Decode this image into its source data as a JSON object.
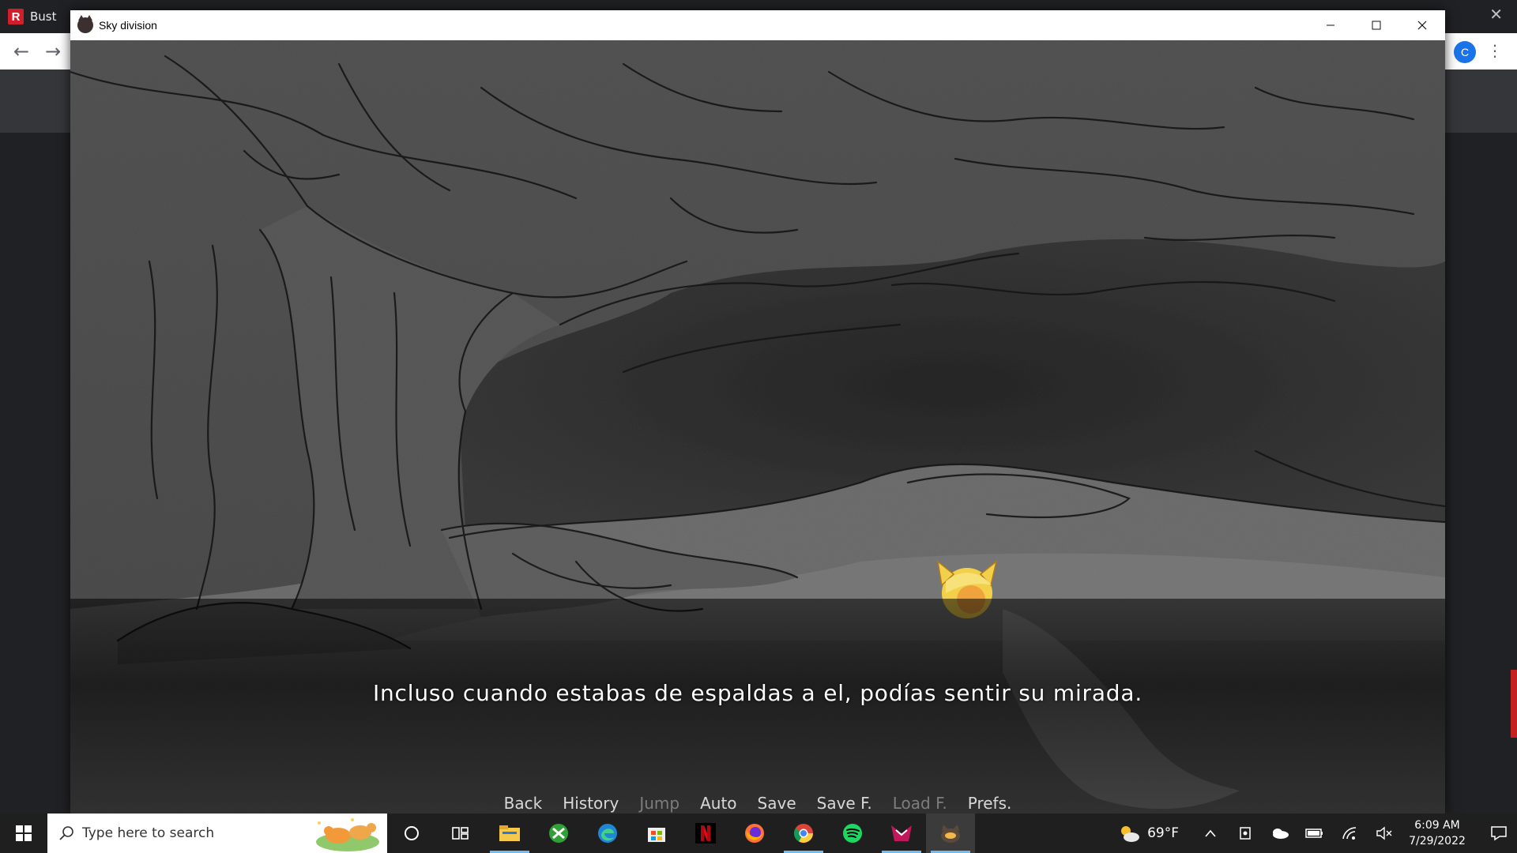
{
  "browser": {
    "first_tab_label": "Bust",
    "profile_initial": "C"
  },
  "window": {
    "title": "Sky division"
  },
  "dialogue": {
    "text": "Incluso cuando estabas de espaldas a el, podías sentir su mirada."
  },
  "quick_menu": [
    {
      "label": "Back",
      "enabled": true
    },
    {
      "label": "History",
      "enabled": true
    },
    {
      "label": "Jump",
      "enabled": false
    },
    {
      "label": "Auto",
      "enabled": true
    },
    {
      "label": "Save",
      "enabled": true
    },
    {
      "label": "Save F.",
      "enabled": true
    },
    {
      "label": "Load F.",
      "enabled": false
    },
    {
      "label": "Prefs.",
      "enabled": true
    }
  ],
  "taskbar": {
    "search_placeholder": "Type here to search",
    "apps": [
      "cortana-icon",
      "task-view-icon",
      "file-explorer-icon",
      "xbox-icon",
      "edge-icon",
      "store-icon",
      "netflix-icon",
      "firefox-icon",
      "chrome-icon",
      "spotify-icon",
      "game-app-icon",
      "sky-division-icon"
    ],
    "weather": "69°F",
    "time": "6:09 AM",
    "date": "7/29/2022"
  },
  "colors": {
    "accent": "#76b9ed",
    "brand_red": "#d11e2a",
    "menu_text": "#d8d8d8",
    "menu_disabled": "#7d7d7d"
  }
}
